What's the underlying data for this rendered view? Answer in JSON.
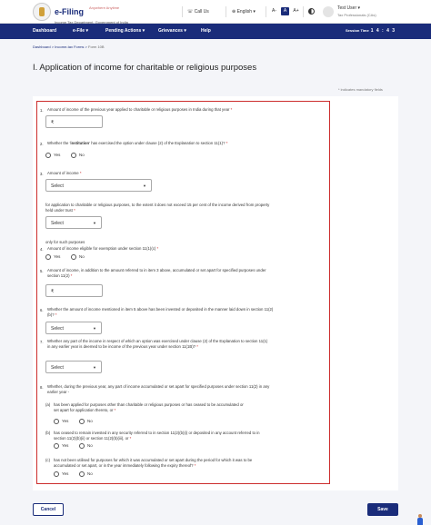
{
  "header": {
    "brand_name": "e-Filing",
    "brand_tagline": "Anywhere Anytime",
    "brand_dept": "Income Tax Department, Government of India",
    "call_us": "Call Us",
    "language": "English",
    "font_sizes": [
      "A-",
      "A",
      "A+"
    ],
    "user_name": "Test User",
    "user_role": "Tax Professionals (CAs)"
  },
  "nav": {
    "items": [
      "Dashboard",
      "e-File",
      "Pending Actions",
      "Grievances",
      "Help"
    ],
    "session_label": "Session Time",
    "session_value": "1 4 : 4 3"
  },
  "breadcrumb": {
    "items": [
      "Dashboard",
      "Income-tax Forms",
      "Form 10B"
    ],
    "separator": ">"
  },
  "page": {
    "title": "I. Application of income for charitable or religious purposes",
    "required_note": "* indicates mandatory fields"
  },
  "form": {
    "q1": {
      "num": "1.",
      "text": "Amount of income of the previous year applied to charitable or religious purposes in India during that year",
      "currency": "₹",
      "value": ""
    },
    "q2": {
      "num": "2.",
      "text_pre": "Whether the '",
      "text_bold": "institution",
      "text_post": "' has exercised the option under clause (2) of the Explanation to section 11(1)?",
      "yes": "Yes",
      "no": "No"
    },
    "q3": {
      "num": "3.",
      "text": "Amount of income",
      "select1": "Select",
      "para": "for application to charitable or religious purposes, to the extent it does not exceed 15 per cent of the income derived from property held under trust",
      "select2": "Select",
      "tail": "only for such purposes"
    },
    "q4": {
      "num": "4.",
      "text": "Amount of income eligible for exemption under section 11(1)(c)",
      "yes": "Yes",
      "no": "No"
    },
    "q5": {
      "num": "5.",
      "text": "Amount of income, in addition to the amount referred to in item 3 above, accumulated or set apart for specified purposes under section 11(2)",
      "currency": "₹",
      "value": ""
    },
    "q6": {
      "num": "6.",
      "text": "Whether the amount of income mentioned in item 5 above has been invested or deposited in the manner laid down in section 11(2)(b)?",
      "select": "Select"
    },
    "q7": {
      "num": "7.",
      "text": "Whether any part of the income in respect of which an option was exercised under clause (2) of the Explanation to section 11(1) in any earlier year is deemed to be income of the previous year under section 11(1B)?",
      "select": "Select"
    },
    "q8": {
      "num": "8.",
      "text": "Whether, during the previous year, any part of income accumulated or set apart for specified purposes under section 11(2) in any earlier year -",
      "a": {
        "label": "(a)",
        "text": "has been applied for purposes other than charitable or religious purposes or has ceased to be accumulated or set apart for application thereto, or",
        "yes": "Yes",
        "no": "No"
      },
      "b": {
        "label": "(b)",
        "text": "has ceased to remain invested in any security referred to in section 11(2)(b)(i) or deposited in any account referred to in section 11(2)(b)(ii) or section 11(2)(b)(iii), or",
        "yes": "Yes",
        "no": "No"
      },
      "c": {
        "label": "(c)",
        "text": "has not been utilised for purposes for which it was accumulated or set apart during the period for which it was to be accumulated or set apart, or in the year immediately following the expiry thereof?",
        "yes": "Yes",
        "no": "No"
      }
    }
  },
  "footer": {
    "cancel": "Cancel",
    "save": "Save"
  },
  "colors": {
    "primary": "#1a2c7a",
    "highlight_border": "#cc2d2d",
    "required": "#cc2d2d"
  },
  "icons": {
    "phone": "phone-icon",
    "globe": "globe-icon",
    "contrast": "contrast-icon",
    "user": "user-avatar-icon",
    "chevron": "chevron-down-icon",
    "rupee": "rupee-icon",
    "helper": "chat-helper-icon"
  }
}
